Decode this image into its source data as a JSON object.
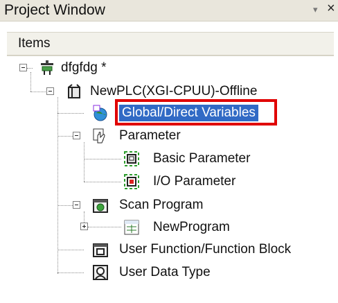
{
  "window": {
    "title": "Project Window",
    "pin_icon": "pin-icon",
    "close_icon": "close-icon"
  },
  "list_header": {
    "column": "Items"
  },
  "tree": {
    "project": {
      "label": "dfgfdg *",
      "icon": "project-icon"
    },
    "plc": {
      "label": "NewPLC(XGI-CPUU)-Offline",
      "icon": "plc-icon"
    },
    "global_vars": {
      "label": "Global/Direct Variables",
      "icon": "globe-variables-icon"
    },
    "parameter": {
      "label": "Parameter",
      "icon": "hand-parameter-icon"
    },
    "basic_param": {
      "label": "Basic Parameter",
      "icon": "basic-parameter-icon"
    },
    "io_param": {
      "label": "I/O Parameter",
      "icon": "io-parameter-icon"
    },
    "scan_program": {
      "label": "Scan Program",
      "icon": "scan-program-icon"
    },
    "new_program": {
      "label": "NewProgram",
      "icon": "program-icon"
    },
    "user_function": {
      "label": "User Function/Function Block",
      "icon": "function-block-icon"
    },
    "user_data_type": {
      "label": "User Data Type",
      "icon": "data-type-icon"
    }
  },
  "colors": {
    "selection": "#316ac5",
    "highlight_box": "#e00000"
  }
}
